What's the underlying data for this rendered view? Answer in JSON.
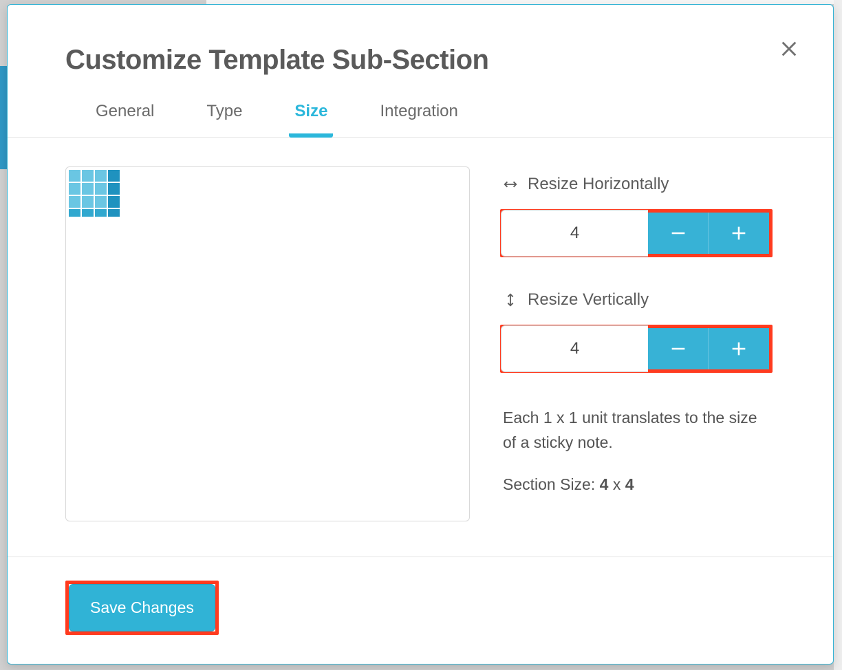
{
  "modal": {
    "title": "Customize Template Sub-Section"
  },
  "tabs": {
    "general": "General",
    "type": "Type",
    "size": "Size",
    "integration": "Integration",
    "active": "size"
  },
  "resize": {
    "horizontal": {
      "label": "Resize Horizontally",
      "value": "4"
    },
    "vertical": {
      "label": "Resize Vertically",
      "value": "4"
    },
    "help": "Each 1 x 1 unit translates to the size of a sticky note.",
    "sizeLabel": "Section Size: ",
    "sizeW": "4",
    "sizeSep": " x ",
    "sizeH": "4"
  },
  "footer": {
    "save": "Save Changes"
  },
  "colors": {
    "accent": "#30b3d6",
    "highlight": "#ff3b1f"
  }
}
